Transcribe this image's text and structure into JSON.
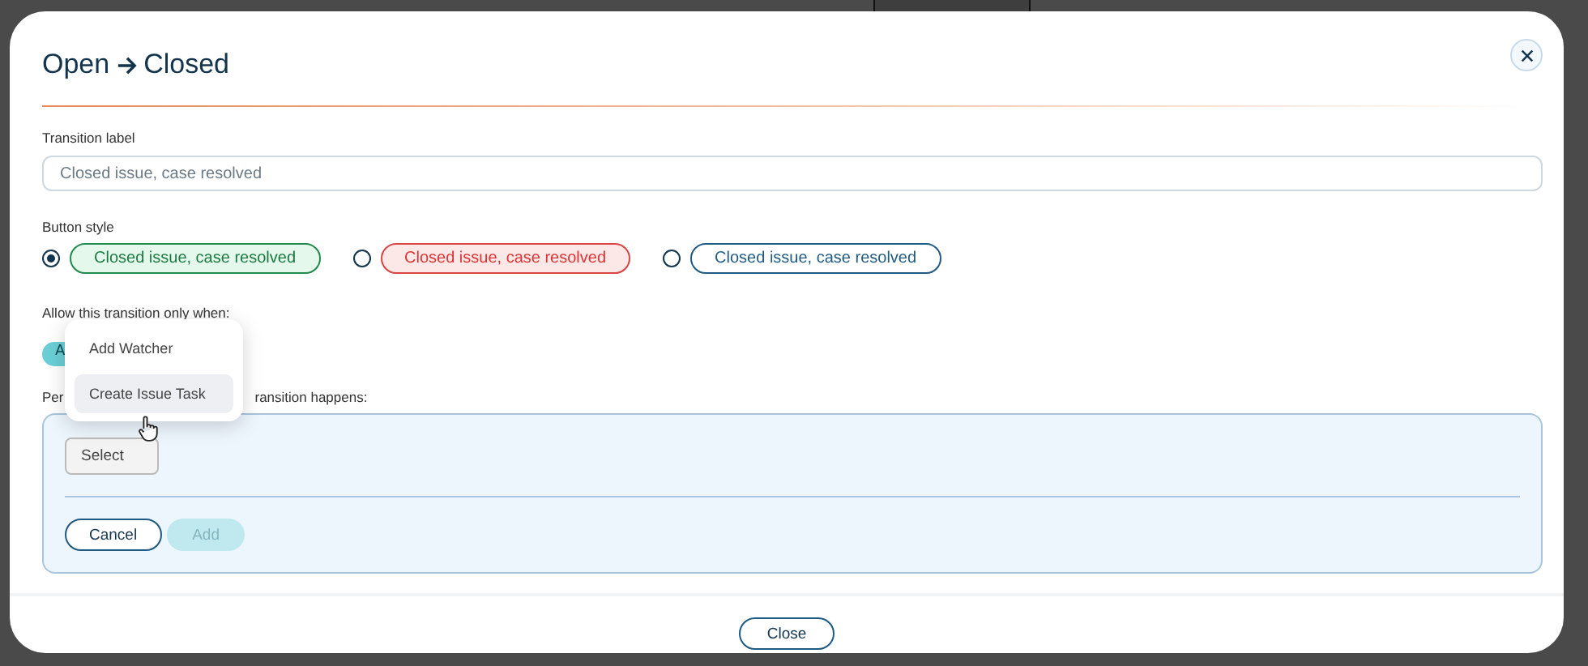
{
  "dialog": {
    "title_from": "Open",
    "title_to": "Closed"
  },
  "transition_label": {
    "label": "Transition label",
    "placeholder": "Closed issue, case resolved"
  },
  "button_style": {
    "label": "Button style",
    "options": [
      {
        "kind": "success",
        "text": "Closed issue, case resolved",
        "selected": true
      },
      {
        "kind": "danger",
        "text": "Closed issue, case resolved",
        "selected": false
      },
      {
        "kind": "primary",
        "text": "Closed issue, case resolved",
        "selected": false
      }
    ]
  },
  "conditions": {
    "label": "Allow this transition only when:",
    "chip": "A"
  },
  "actions": {
    "label_start": "Per",
    "label_end": "ransition happens:",
    "select": "Select",
    "cancel": "Cancel",
    "add": {
      "text": "Add",
      "disabled": true
    }
  },
  "menu": {
    "items": [
      {
        "text": "Add Watcher",
        "selected": false
      },
      {
        "text": "Create Issue Task",
        "selected": true
      }
    ]
  },
  "footer": {
    "close": "Close"
  }
}
